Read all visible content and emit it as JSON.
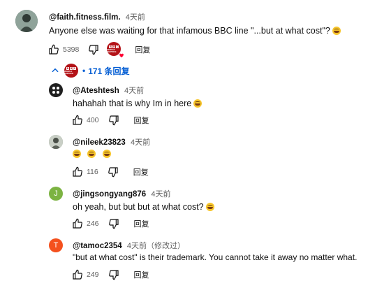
{
  "top_comment": {
    "author": "@faith.fitness.film.",
    "time": "4天前",
    "text": "Anyone else was waiting for that infamous BBC line \"...but at what cost\"?",
    "like_count": "5398",
    "reply_label": "回复"
  },
  "replies_toggle": {
    "count_label": "171 条回复",
    "separator": "•"
  },
  "replies": [
    {
      "author": "@Ateshtesh",
      "time": "4天前",
      "text": "hahahah that is why Im in here",
      "like_count": "400",
      "reply_label": "回复",
      "avatar_letter": "",
      "avatar_color": "#1f1f1f"
    },
    {
      "author": "@nileek23823",
      "time": "4天前",
      "text": "",
      "like_count": "116",
      "reply_label": "回复",
      "avatar_letter": "",
      "avatar_color": "#6b7a6a"
    },
    {
      "author": "@jingsongyang876",
      "time": "4天前",
      "text": "oh yeah, but but but at what cost?",
      "like_count": "246",
      "reply_label": "回复",
      "avatar_letter": "J",
      "avatar_color": "#7cb342"
    },
    {
      "author": "@tamoc2354",
      "time": "4天前（修改过）",
      "text": "\"but at what cost\" is their trademark. You cannot take it away no matter what.",
      "like_count": "249",
      "reply_label": "回复",
      "avatar_letter": "T",
      "avatar_color": "#f4511e"
    }
  ],
  "badge": {
    "text": "WORLD SERVICE"
  }
}
